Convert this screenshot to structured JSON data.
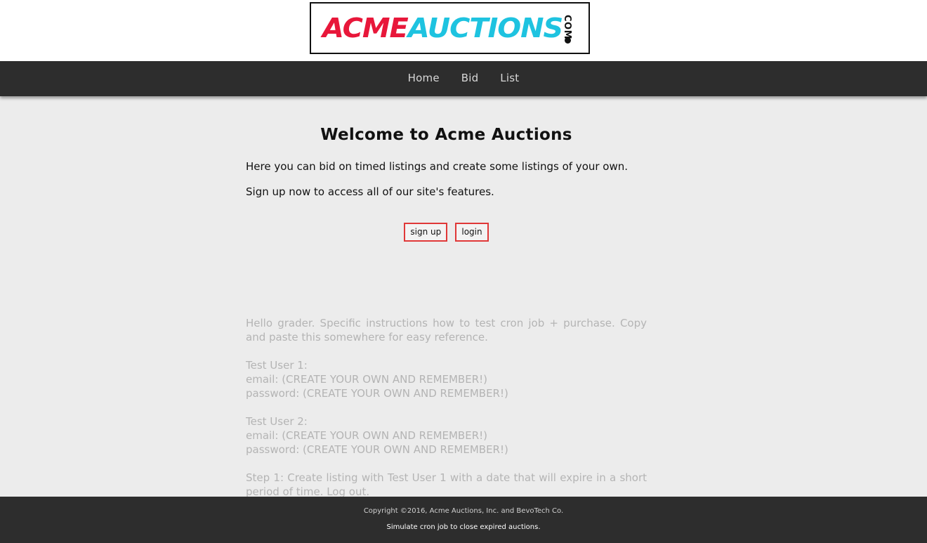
{
  "logo": {
    "part1": "ACME",
    "part2": "AUCTIONS",
    "suffix": "COM"
  },
  "nav": {
    "home": "Home",
    "bid": "Bid",
    "list": "List"
  },
  "main": {
    "title": "Welcome to Acme Auctions",
    "paragraph1": "Here you can bid on timed listings and create some listings of your own.",
    "paragraph2": "Sign up now to access all of our site's features.",
    "signup_label": "sign up",
    "login_label": "login"
  },
  "grader": {
    "intro": "Hello grader. Specific instructions how to test cron job + purchase. Copy and paste this somewhere for easy reference.",
    "user1_title": "Test User 1:",
    "user1_email": "email: (CREATE YOUR OWN AND REMEMBER!)",
    "user1_password": "password: (CREATE YOUR OWN AND REMEMBER!)",
    "user2_title": "Test User 2:",
    "user2_email": "email: (CREATE YOUR OWN AND REMEMBER!)",
    "user2_password": "password: (CREATE YOUR OWN AND REMEMBER!)",
    "step1": "Step 1: Create listing with Test User 1 with a date that will expire in a short period of time. Log out."
  },
  "footer": {
    "copyright": "Copyright ©2016, Acme Auctions, Inc. and BevoTech Co.",
    "cron_link": "Simulate cron job to close expired auctions."
  },
  "colors": {
    "accent_red": "#e8173a",
    "accent_cyan": "#1ec3e0",
    "nav_bg": "#2d2d2d",
    "button_border": "#e03838"
  }
}
